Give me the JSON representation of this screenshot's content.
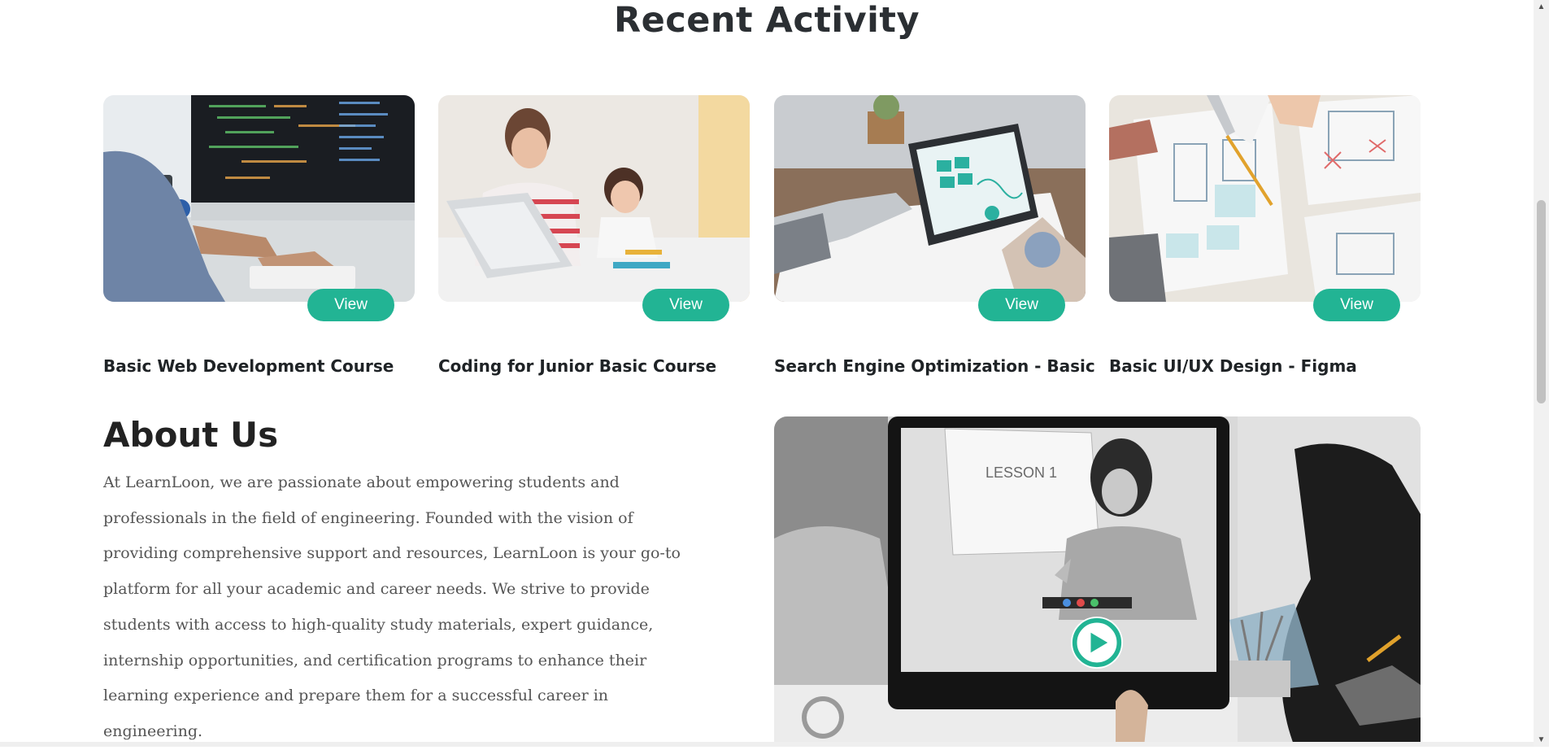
{
  "recent_activity": {
    "title": "Recent Activity",
    "courses": [
      {
        "title": "Basic Web Development Course",
        "button": "View",
        "image": "developer-coding-photo"
      },
      {
        "title": "Coding for Junior Basic Course",
        "button": "View",
        "image": "mother-child-laptop-photo"
      },
      {
        "title": "Search Engine Optimization - Basic",
        "button": "View",
        "image": "tablet-analytics-photo"
      },
      {
        "title": "Basic UI/UX Design - Figma",
        "button": "View",
        "image": "wireframe-sketching-photo"
      }
    ]
  },
  "about": {
    "title": "About Us",
    "text": "At LearnLoon, we are passionate about empowering students and professionals in the field of engineering. Founded with the vision of providing comprehensive support and resources, LearnLoon is your go-to platform for all your academic and career needs. We strive to provide students with access to high-quality study materials, expert guidance, internship opportunities, and certification programs to enhance their learning experience and prepare them for a successful career in engineering.",
    "video": {
      "lesson_label": "LESSON 1",
      "play_icon": "play-icon"
    }
  },
  "colors": {
    "accent": "#22b494",
    "heading": "#222222",
    "body_text": "#555555"
  }
}
